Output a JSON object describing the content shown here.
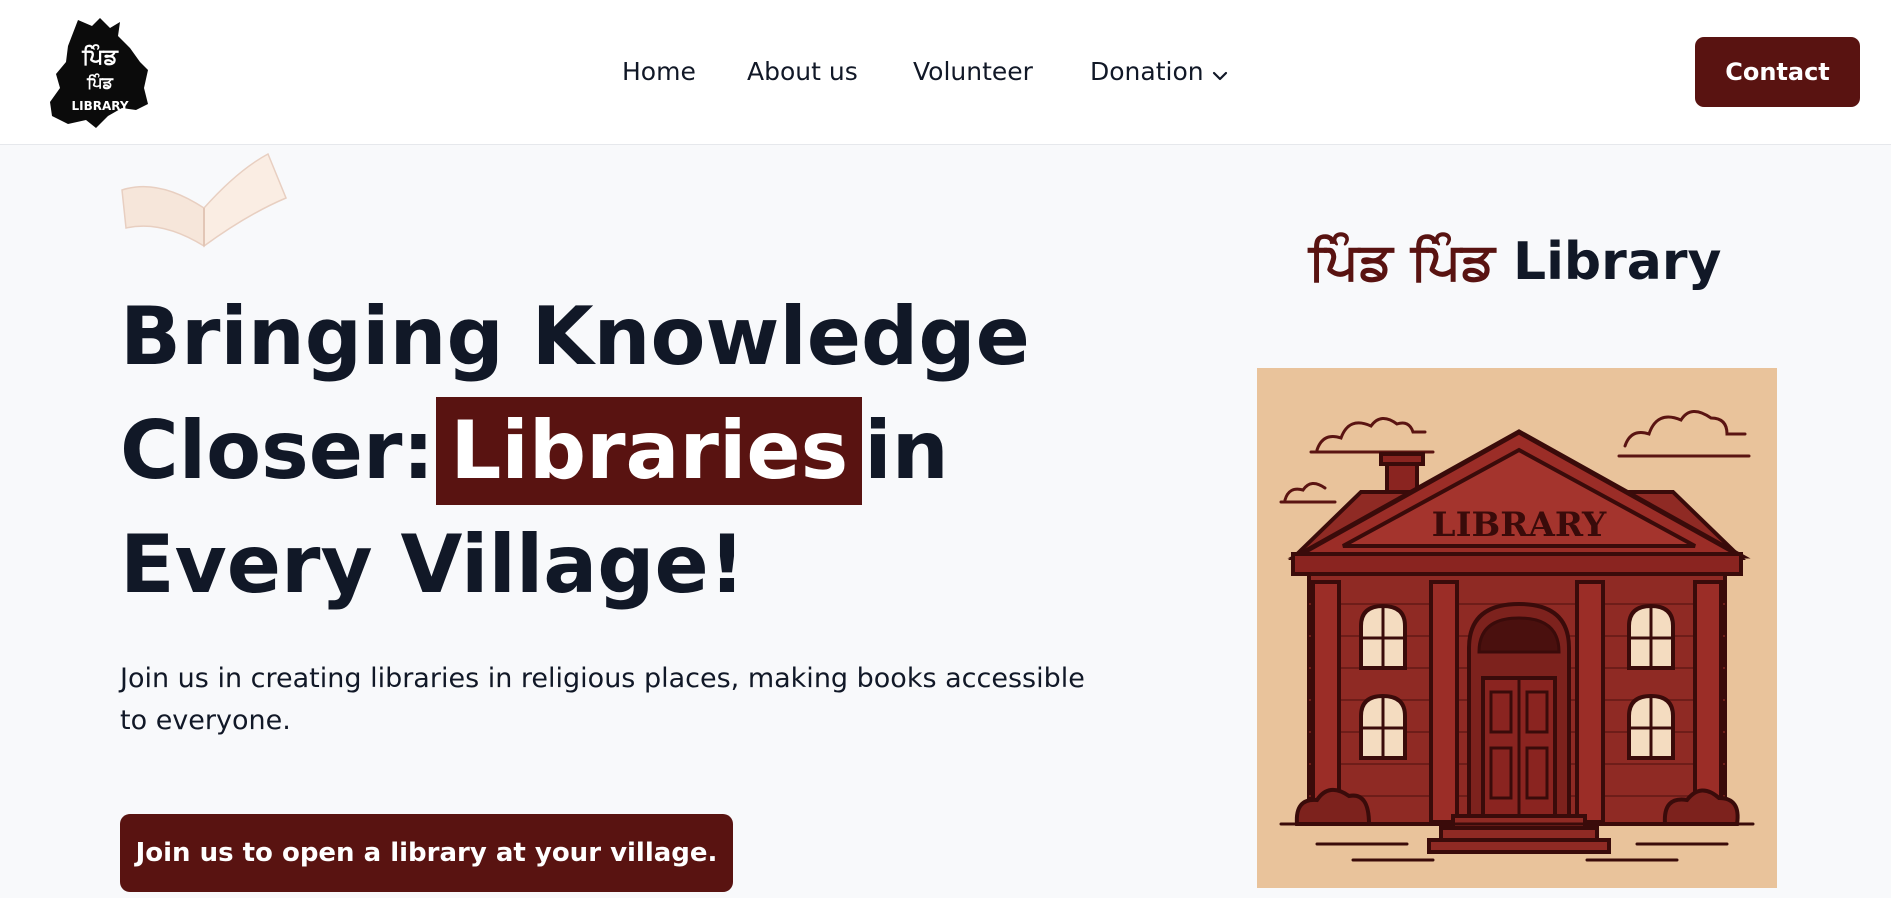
{
  "header": {
    "logo": {
      "text_top": "ਪਿੰਡ",
      "text_mid": "ਪਿੰਡ",
      "text_bottom": "LIBRARY"
    },
    "nav": [
      {
        "label": "Home"
      },
      {
        "label": "About us"
      },
      {
        "label": "Volunteer"
      },
      {
        "label": "Donation",
        "icon": "chevron-down-icon"
      }
    ],
    "contact_label": "Contact"
  },
  "hero": {
    "headline_line1": "Bringing Knowledge",
    "headline_line2_a": "Closer:",
    "headline_highlight": "Libraries",
    "headline_line2_b": "in",
    "headline_line3": "Every Village!",
    "subtitle": "Join us in creating libraries in religious places, making books accessible to everyone.",
    "cta_label": "Join us to open a library at your village."
  },
  "brand": {
    "punjabi": "ਪਿੰਡ ਪਿੰਡ",
    "english": "Library"
  },
  "illustration": {
    "sign_text": "LIBRARY"
  },
  "colors": {
    "accent": "#591311",
    "background": "#f8f9fb",
    "text": "#111827",
    "illustration_bg": "#e9c39b"
  }
}
